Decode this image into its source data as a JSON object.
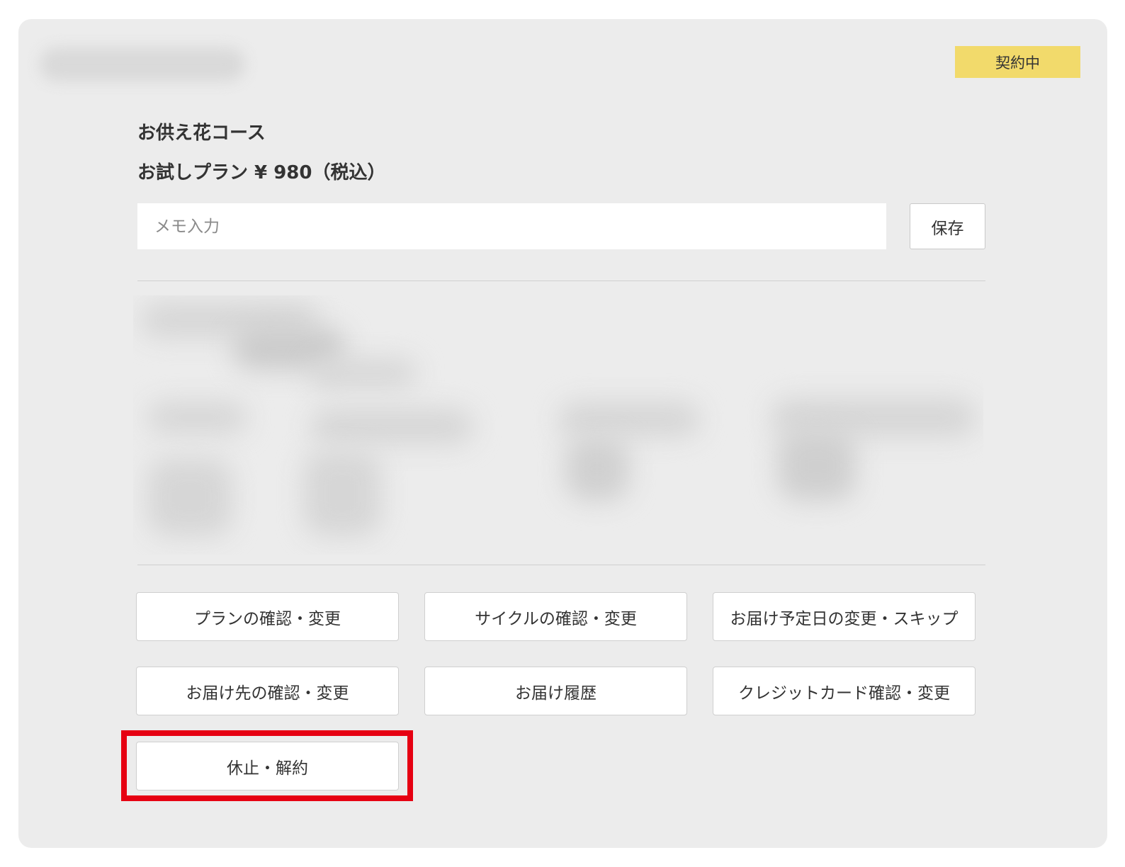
{
  "status_badge": {
    "label": "契約中",
    "color": "#f2da6b"
  },
  "subscription": {
    "course_name": "お供え花コース",
    "plan_text": "お試しプラン ¥ 980（税込）"
  },
  "memo": {
    "placeholder": "メモ入力",
    "value": "",
    "save_label": "保存"
  },
  "actions": [
    {
      "label": "プランの確認・変更"
    },
    {
      "label": "サイクルの確認・変更"
    },
    {
      "label": "お届け予定日の変更・スキップ"
    },
    {
      "label": "お届け先の確認・変更"
    },
    {
      "label": "お届け履歴"
    },
    {
      "label": "クレジットカード確認・変更"
    },
    {
      "label": "休止・解約"
    }
  ],
  "highlight_color": "#e60012"
}
